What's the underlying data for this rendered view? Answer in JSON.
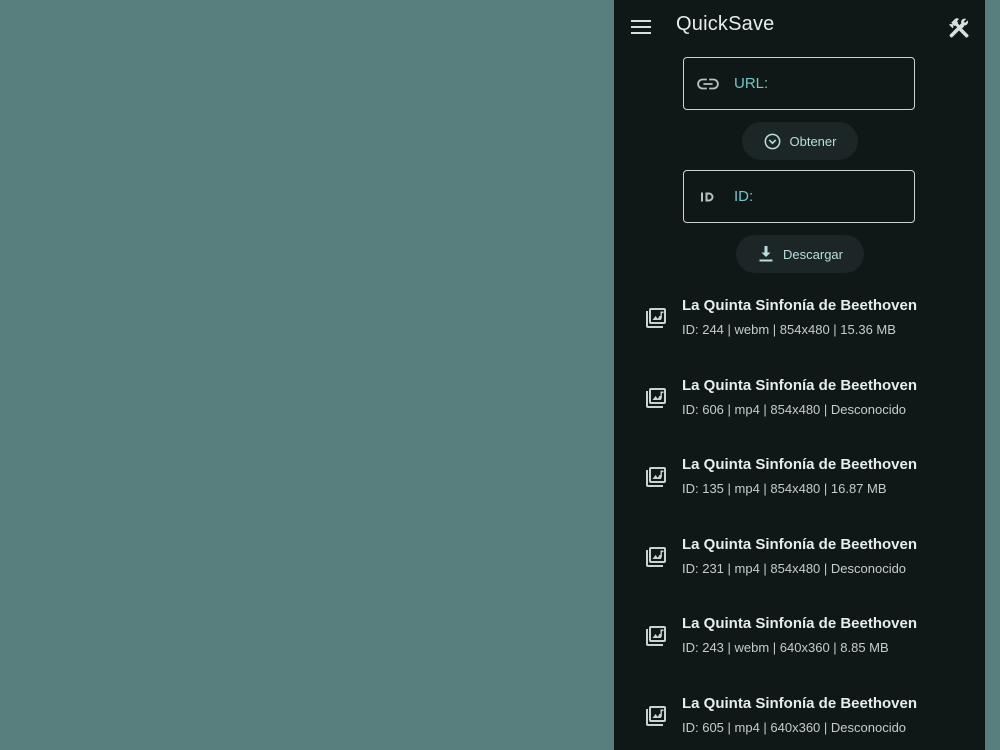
{
  "app": {
    "title": "QuickSave"
  },
  "form": {
    "url_label": "URL:",
    "url_value": "",
    "fetch_label": "Obtener",
    "id_label": "ID:",
    "id_value": "",
    "download_label": "Descargar"
  },
  "icons": {
    "menu": "menu-icon",
    "tools": "tools-icon",
    "url": "link-icon",
    "fetch": "chevron-circle-down-icon",
    "id": "id-icon",
    "download": "download-icon",
    "item": "music-video-library-icon"
  },
  "colors": {
    "background": "#587e7e",
    "panel": "#101717",
    "accent": "#6fc8c8",
    "button": "#1c2626"
  },
  "formats": [
    {
      "title": "La Quinta Sinfonía de Beethoven",
      "details": "ID: 244 | webm | 854x480 | 15.36 MB"
    },
    {
      "title": "La Quinta Sinfonía de Beethoven",
      "details": "ID: 606 | mp4 | 854x480 | Desconocido"
    },
    {
      "title": "La Quinta Sinfonía de Beethoven",
      "details": "ID: 135 | mp4 | 854x480 | 16.87 MB"
    },
    {
      "title": "La Quinta Sinfonía de Beethoven",
      "details": "ID: 231 | mp4 | 854x480 | Desconocido"
    },
    {
      "title": "La Quinta Sinfonía de Beethoven",
      "details": "ID: 243 | webm | 640x360 | 8.85 MB"
    },
    {
      "title": "La Quinta Sinfonía de Beethoven",
      "details": "ID: 605 | mp4 | 640x360 | Desconocido"
    }
  ]
}
